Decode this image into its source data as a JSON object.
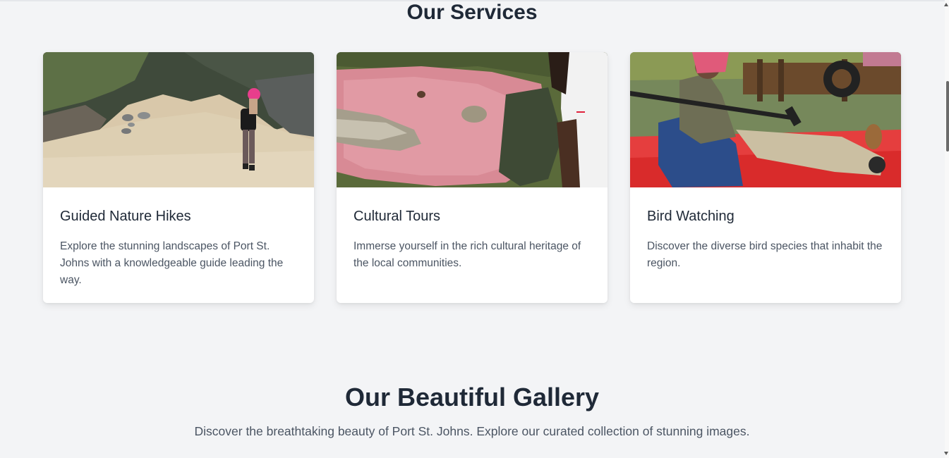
{
  "services": {
    "title": "Our Services",
    "cards": [
      {
        "title": "Guided Nature Hikes",
        "description": "Explore the stunning landscapes of Port St. Johns with a knowledgeable guide leading the way."
      },
      {
        "title": "Cultural Tours",
        "description": "Immerse yourself in the rich cultural heritage of the local communities."
      },
      {
        "title": "Bird Watching",
        "description": "Discover the diverse bird species that inhabit the region."
      }
    ]
  },
  "gallery": {
    "title": "Our Beautiful Gallery",
    "subtitle": "Discover the breathtaking beauty of Port St. Johns. Explore our curated collection of stunning images."
  },
  "colors": {
    "page_background": "#f3f4f6",
    "card_background": "#ffffff",
    "heading": "#1f2937",
    "body_text": "#4b5563"
  }
}
